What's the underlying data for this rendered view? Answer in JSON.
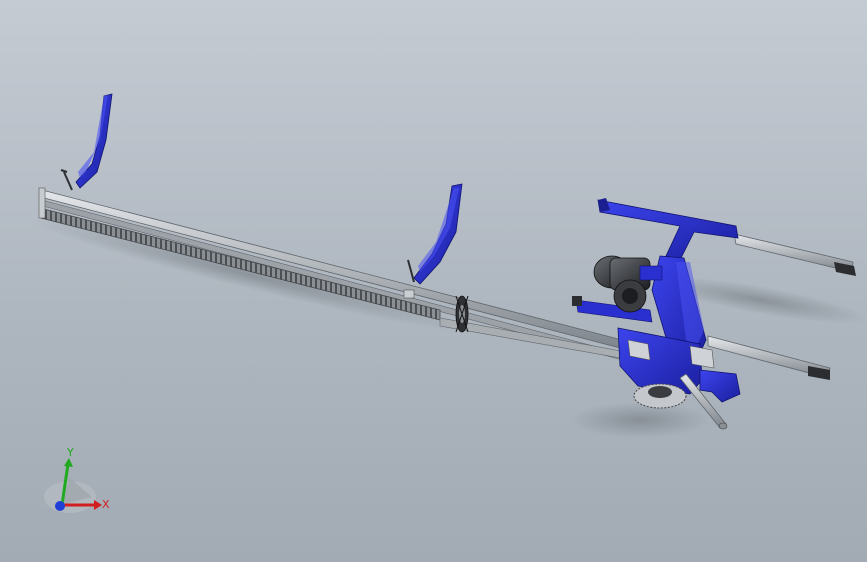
{
  "triad": {
    "x_label": "X",
    "y_label": "Y",
    "x_color": "#d21e1e",
    "y_color": "#1faa1f",
    "z_color": "#1f3fd6"
  },
  "colors": {
    "frame_blue": "#2a2fd0",
    "frame_blue_dark": "#141a8a",
    "rail_steel": "#8c9298",
    "rail_light": "#d6dadd",
    "motor_dark": "#2b2d30"
  }
}
